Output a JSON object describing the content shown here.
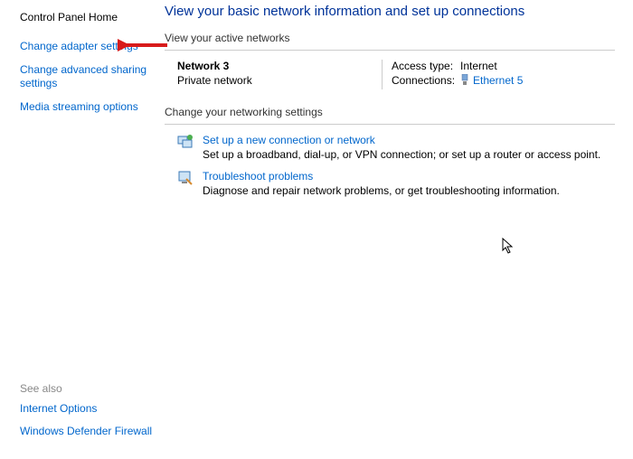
{
  "sidebar": {
    "home": "Control Panel Home",
    "links": [
      "Change adapter settings",
      "Change advanced sharing settings",
      "Media streaming options"
    ],
    "see_also_header": "See also",
    "see_also": [
      "Internet Options",
      "Windows Defender Firewall"
    ]
  },
  "main": {
    "title": "View your basic network information and set up connections",
    "active_header": "View your active networks",
    "network": {
      "name": "Network 3",
      "type": "Private network",
      "access_label": "Access type:",
      "access_value": "Internet",
      "conn_label": "Connections:",
      "conn_value": "Ethernet 5"
    },
    "change_header": "Change your networking settings",
    "settings": [
      {
        "title": "Set up a new connection or network",
        "desc": "Set up a broadband, dial-up, or VPN connection; or set up a router or access point."
      },
      {
        "title": "Troubleshoot problems",
        "desc": "Diagnose and repair network problems, or get troubleshooting information."
      }
    ]
  }
}
